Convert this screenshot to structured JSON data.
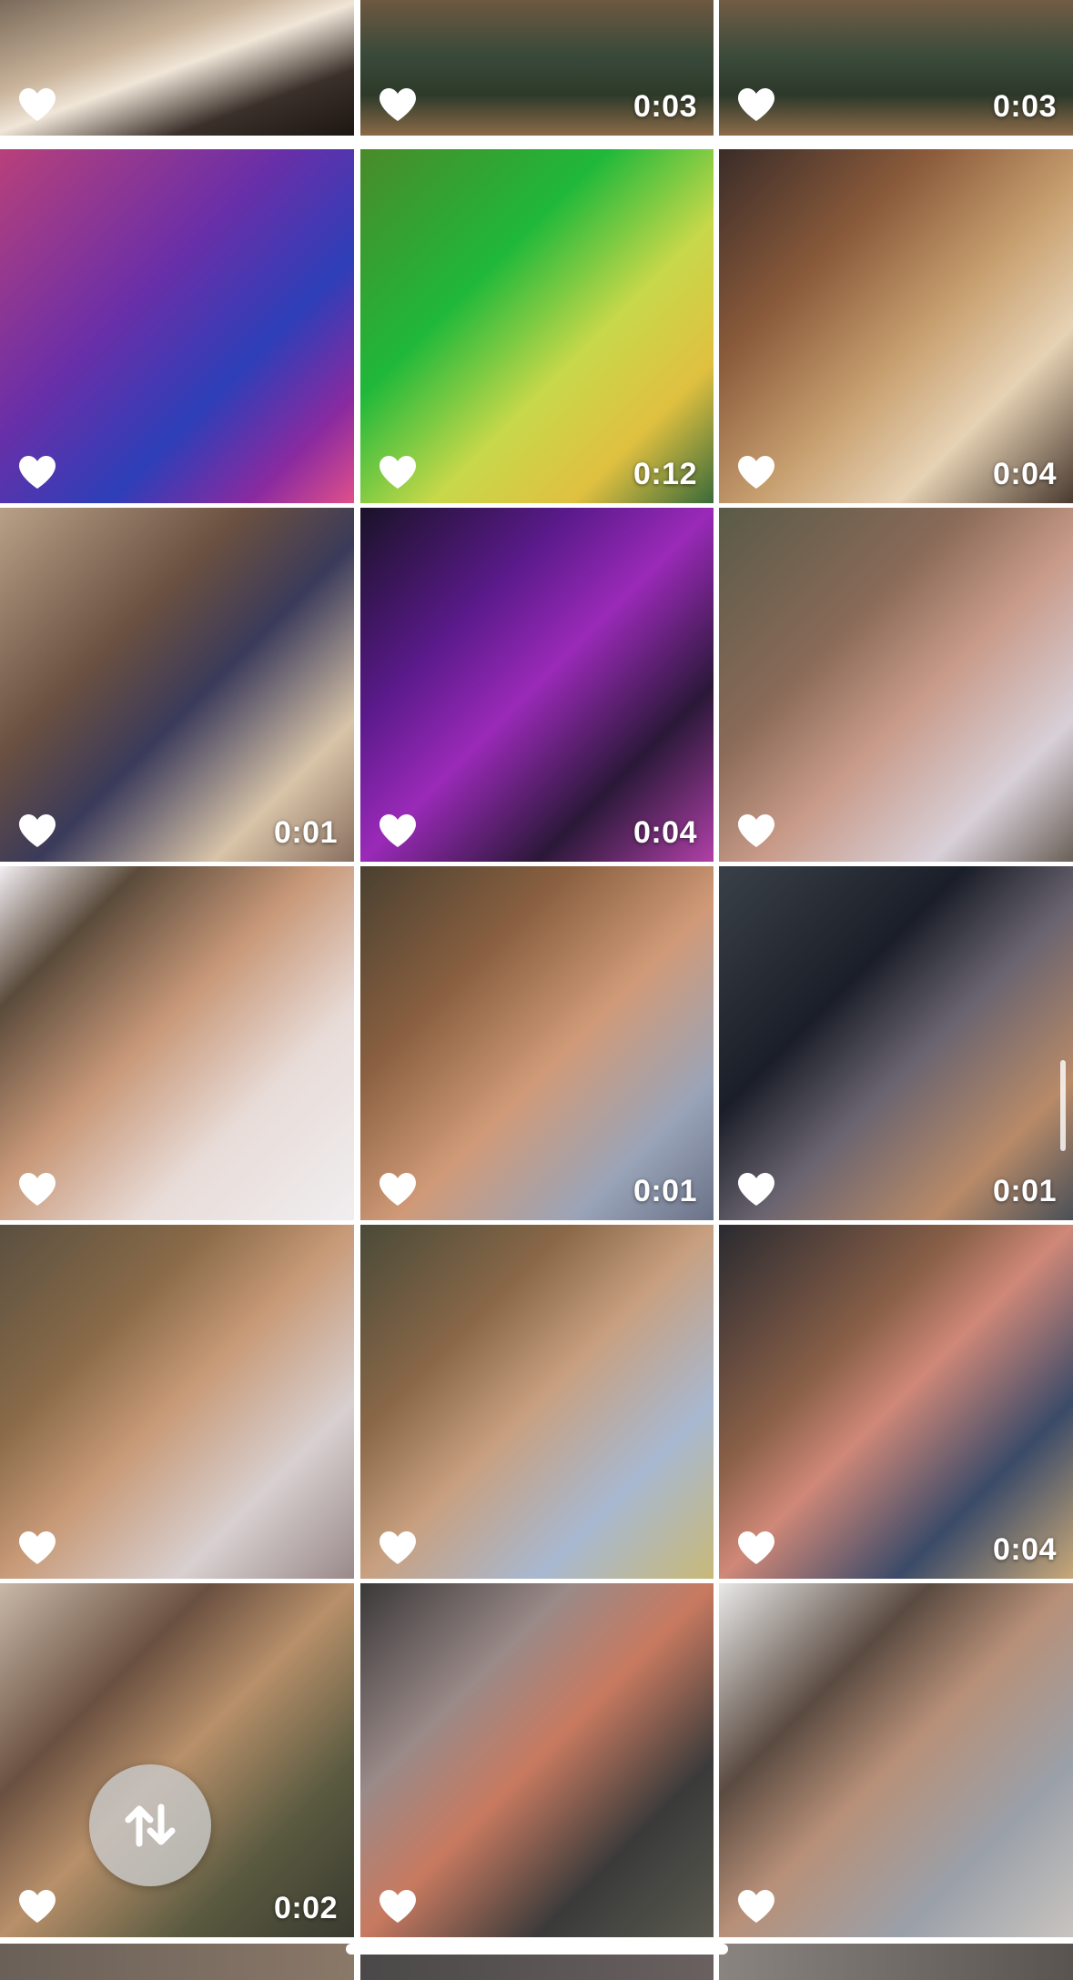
{
  "grid": {
    "tiles": [
      {
        "duration": "",
        "tone": "linear-gradient(160deg,#7a6a5a 0%,#c9b39a 35%,#f0e6d8 50%,#3b302a 75%,#1c1612 100%)",
        "liked": true
      },
      {
        "duration": "0:03",
        "tone": "linear-gradient(180deg,#6e5840 0%,#3a4a3a 40%,#2d3a2a 70%,#8b6a48 100%)",
        "liked": true
      },
      {
        "duration": "0:03",
        "tone": "linear-gradient(180deg,#725c44 0%,#3c4c3b 40%,#2c382a 70%,#8d6c4a 100%)",
        "liked": true
      },
      {
        "duration": "",
        "tone": "linear-gradient(135deg,#b8407a 0%,#6a2fa8 40%,#2d3fb8 65%,#8a2aa0 85%,#e0508a 100%)",
        "liked": true
      },
      {
        "duration": "0:12",
        "tone": "linear-gradient(135deg,#4a8a2a 0%,#1fb83a 35%,#c8d84a 60%,#e0c040 80%,#3a6a3a 100%)",
        "liked": true
      },
      {
        "duration": "0:04",
        "tone": "linear-gradient(135deg,#3a2c28 0%,#8a5a3a 30%,#c8a070 55%,#e6d2b4 75%,#4a3a30 100%)",
        "liked": true
      },
      {
        "duration": "0:01",
        "tone": "linear-gradient(135deg,#b8a088 0%,#6a5040 35%,#3a3a5a 55%,#d8c4a8 80%,#8a7060 100%)",
        "liked": true
      },
      {
        "duration": "0:04",
        "tone": "linear-gradient(135deg,#1a1228 0%,#5a1a8a 30%,#9a2ab8 50%,#2a1838 75%,#b040a8 100%)",
        "liked": true
      },
      {
        "duration": "",
        "tone": "linear-gradient(135deg,#5a5a48 0%,#8a6a58 35%,#c89a88 55%,#d8d0d8 80%,#6a6058 100%)",
        "liked": true
      },
      {
        "duration": "",
        "tone": "linear-gradient(135deg,#f2eef2 0%,#5a4a3a 20%,#c89878 45%,#e8dcd8 70%,#f0eef0 100%)",
        "liked": true
      },
      {
        "duration": "0:01",
        "tone": "linear-gradient(135deg,#4a4030 0%,#8a6040 30%,#d09a78 55%,#9aa4b8 80%,#6a7288 100%)",
        "liked": true
      },
      {
        "duration": "0:01",
        "tone": "linear-gradient(135deg,#3a4048 0%,#1a1e28 35%,#6a6470 55%,#b88a68 80%,#4a5058 100%)",
        "liked": true
      },
      {
        "duration": "",
        "tone": "linear-gradient(135deg,#5a5040 0%,#8a6a48 30%,#c89a78 50%,#d8d0d0 75%,#9a8a8a 100%)",
        "liked": true
      },
      {
        "duration": "",
        "tone": "linear-gradient(135deg,#4a4a38 0%,#8a6848 30%,#c8a080 50%,#a8b8d0 75%,#c8b878 100%)",
        "liked": true
      },
      {
        "duration": "0:04",
        "tone": "linear-gradient(135deg,#2a2a30 0%,#8a6048 35%,#d08878 50%,#3a4a68 75%,#c8a878 100%)",
        "liked": true
      },
      {
        "duration": "0:02",
        "tone": "linear-gradient(135deg,#c8b8a8 0%,#6a5040 30%,#b8906a 50%,#5a5a40 75%,#3a3a30 100%)",
        "liked": true
      },
      {
        "duration": "",
        "tone": "linear-gradient(135deg,#3a3838 0%,#9a8a88 30%,#c87a60 50%,#3a3a3a 75%,#5a5a50 100%)",
        "liked": true
      },
      {
        "duration": "",
        "tone": "linear-gradient(135deg,#e8e8e8 0%,#5a4a40 30%,#b89078 50%,#9aa0a8 75%,#c8c4c0 100%)",
        "liked": true
      }
    ],
    "bottom_strip": [
      "linear-gradient(90deg,#6a6058,#8a7868)",
      "linear-gradient(90deg,#4a4848,#6a6060)",
      "linear-gradient(90deg,#8a8480,#5a5450)"
    ]
  },
  "sort_button": {
    "icon": "sort-arrows-icon"
  },
  "colors": {
    "heart": "#ffffff",
    "duration_text": "#ffffff",
    "sort_button_bg": "#c8c8c8"
  }
}
